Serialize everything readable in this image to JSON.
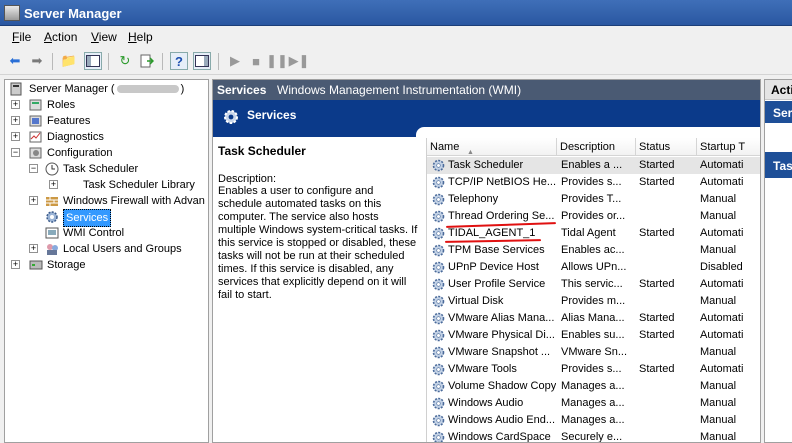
{
  "window": {
    "title": "Server Manager"
  },
  "menu": [
    "File",
    "Action",
    "View",
    "Help"
  ],
  "toolbar": {
    "icons": [
      "back-arrow-icon",
      "forward-arrow-icon",
      "up-folder-icon",
      "show-hide-tree-icon",
      "refresh-icon",
      "export-list-icon",
      "help-icon",
      "properties-icon",
      "play-icon",
      "stop-icon",
      "pause-icon",
      "restart-icon"
    ]
  },
  "tree": {
    "root": "Server Manager (",
    "root_suffix": ")",
    "items": [
      {
        "label": "Roles"
      },
      {
        "label": "Features"
      },
      {
        "label": "Diagnostics"
      },
      {
        "label": "Configuration"
      },
      {
        "label": "Task Scheduler"
      },
      {
        "label": "Task Scheduler Library"
      },
      {
        "label": "Windows Firewall with Advan"
      },
      {
        "label": "Services"
      },
      {
        "label": "WMI Control"
      },
      {
        "label": "Local Users and Groups"
      },
      {
        "label": "Storage"
      }
    ]
  },
  "center": {
    "header_bold": "Services",
    "header_sub": "Windows Management Instrumentation (WMI)",
    "banner_title": "Services",
    "selected_service": "Task Scheduler",
    "description_label": "Description:",
    "description": "Enables a user to configure and schedule automated tasks on this computer. The service also hosts multiple Windows system-critical tasks. If this service is stopped or disabled, these tasks will not be run at their scheduled times. If this service is disabled, any services that explicitly depend on it will fail to start."
  },
  "table": {
    "columns": [
      "Name",
      "Description",
      "Status",
      "Startup T"
    ],
    "rows": [
      {
        "name": "Task Scheduler",
        "description": "Enables a ...",
        "status": "Started",
        "startup": "Automati"
      },
      {
        "name": "TCP/IP NetBIOS He...",
        "description": "Provides s...",
        "status": "Started",
        "startup": "Automati"
      },
      {
        "name": "Telephony",
        "description": "Provides T...",
        "status": "",
        "startup": "Manual"
      },
      {
        "name": "Thread Ordering Se...",
        "description": "Provides or...",
        "status": "",
        "startup": "Manual"
      },
      {
        "name": "TIDAL_AGENT_1",
        "description": "Tidal Agent",
        "status": "Started",
        "startup": "Automati"
      },
      {
        "name": "TPM Base Services",
        "description": "Enables ac...",
        "status": "",
        "startup": "Manual"
      },
      {
        "name": "UPnP Device Host",
        "description": "Allows UPn...",
        "status": "",
        "startup": "Disabled"
      },
      {
        "name": "User Profile Service",
        "description": "This servic...",
        "status": "Started",
        "startup": "Automati"
      },
      {
        "name": "Virtual Disk",
        "description": "Provides m...",
        "status": "",
        "startup": "Manual"
      },
      {
        "name": "VMware Alias Mana...",
        "description": "Alias Mana...",
        "status": "Started",
        "startup": "Automati"
      },
      {
        "name": "VMware Physical Di...",
        "description": "Enables su...",
        "status": "Started",
        "startup": "Automati"
      },
      {
        "name": "VMware Snapshot ...",
        "description": "VMware Sn...",
        "status": "",
        "startup": "Manual"
      },
      {
        "name": "VMware Tools",
        "description": "Provides s...",
        "status": "Started",
        "startup": "Automati"
      },
      {
        "name": "Volume Shadow Copy",
        "description": "Manages a...",
        "status": "",
        "startup": "Manual"
      },
      {
        "name": "Windows Audio",
        "description": "Manages a...",
        "status": "",
        "startup": "Manual"
      },
      {
        "name": "Windows Audio End...",
        "description": "Manages a...",
        "status": "",
        "startup": "Manual"
      },
      {
        "name": "Windows CardSpace",
        "description": "Securely e...",
        "status": "",
        "startup": "Manual"
      }
    ]
  },
  "actions": {
    "header": "Acti",
    "band1": "Ser",
    "band2": "Tas"
  },
  "colors": {
    "selection": "#3399ff",
    "banner": "#0b3a8a",
    "annotation": "#e01010"
  }
}
